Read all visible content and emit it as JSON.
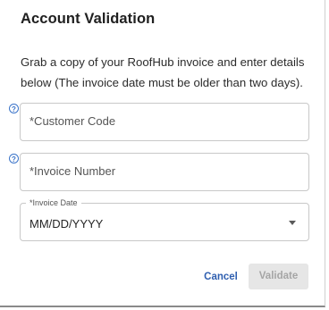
{
  "dialog": {
    "title": "Account Validation",
    "description": "Grab a copy of your RoofHub invoice and enter details below (The invoice date must be older than two days)."
  },
  "fields": {
    "customer_code": {
      "placeholder": "*Customer Code",
      "help_icon": "question-icon"
    },
    "invoice_number": {
      "placeholder": "*Invoice Number",
      "help_icon": "question-icon"
    },
    "invoice_date": {
      "label": "*Invoice Date",
      "value": "MM/DD/YYYY",
      "icon": "chevron-down-icon"
    }
  },
  "actions": {
    "cancel_label": "Cancel",
    "validate_label": "Validate"
  },
  "colors": {
    "link_blue": "#2f5fb0",
    "help_blue": "#3b74c9",
    "disabled_button": "#e6e6e6"
  }
}
